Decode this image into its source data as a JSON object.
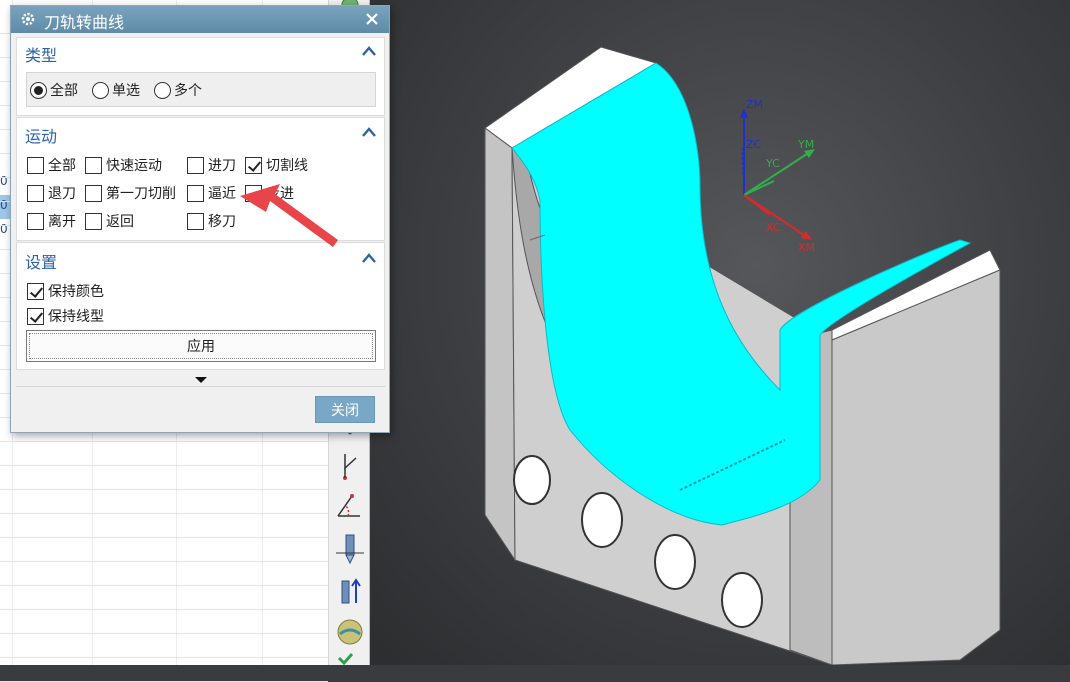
{
  "dialog": {
    "title": "刀轨转曲线",
    "close_symbol": "✕"
  },
  "type_group": {
    "title": "类型",
    "options": [
      {
        "label": "全部",
        "selected": true
      },
      {
        "label": "单选",
        "selected": false
      },
      {
        "label": "多个",
        "selected": false
      }
    ]
  },
  "motion_group": {
    "title": "运动",
    "checkboxes": [
      {
        "label": "全部",
        "checked": false
      },
      {
        "label": "快速运动",
        "checked": false
      },
      {
        "label": "进刀",
        "checked": false
      },
      {
        "label": "切割线",
        "checked": true
      },
      {
        "label": "退刀",
        "checked": false
      },
      {
        "label": "第一刀切削",
        "checked": false
      },
      {
        "label": "逼近",
        "checked": false
      },
      {
        "label": "步进",
        "checked": false
      },
      {
        "label": "离开",
        "checked": false
      },
      {
        "label": "返回",
        "checked": false
      },
      {
        "label": "移刀",
        "checked": false
      }
    ]
  },
  "settings_group": {
    "title": "设置",
    "checkboxes": [
      {
        "label": "保持颜色",
        "checked": true
      },
      {
        "label": "保持线型",
        "checked": true
      }
    ],
    "apply_label": "应用"
  },
  "footer": {
    "close_label": "关闭"
  },
  "background_table": {
    "row_numbers": [
      "0",
      "0",
      "0"
    ]
  },
  "viewport": {
    "axes": {
      "zm": "ZM",
      "zc": "ZC",
      "yc": "YC",
      "ym": "YM",
      "xc": "XC",
      "xm": "XM"
    }
  },
  "colors": {
    "title_bar": "#6a95b0",
    "group_title": "#2f63a8",
    "surface_cyan": "#00ffff",
    "annotation_arrow": "#e8454a",
    "z_axis": "#2030c8",
    "y_axis": "#2fb04a",
    "x_axis": "#d82a2a"
  }
}
